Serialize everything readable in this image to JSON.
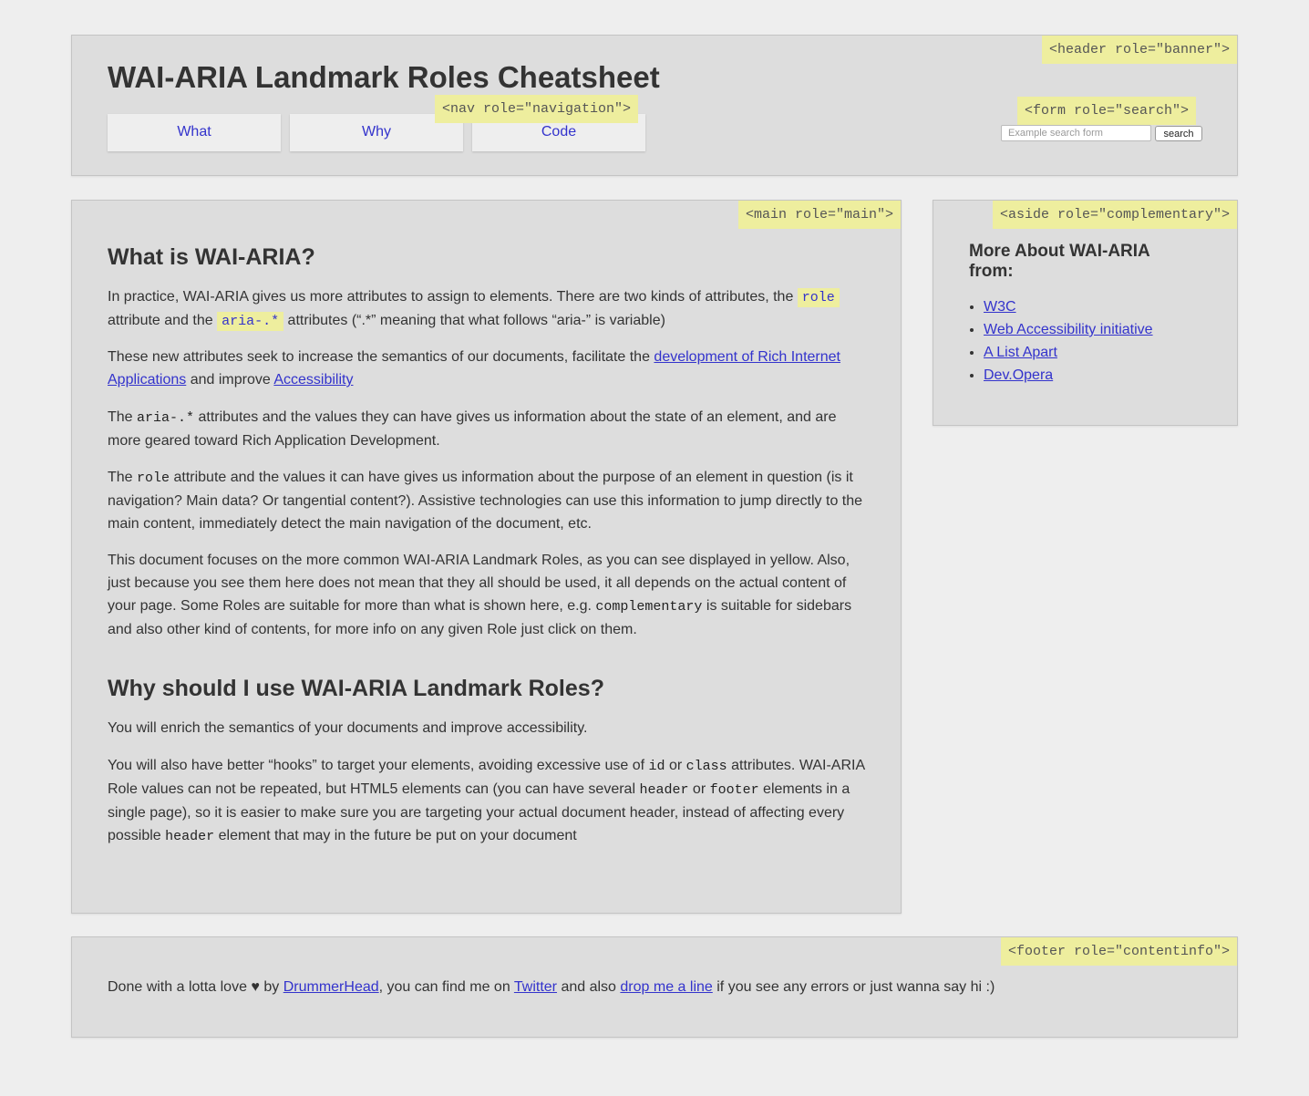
{
  "header": {
    "title": "WAI-ARIA Landmark Roles Cheatsheet",
    "role_tag": "<header role=\"banner\">",
    "nav_tag": "<nav role=\"navigation\">",
    "nav": [
      {
        "label": "What"
      },
      {
        "label": "Why"
      },
      {
        "label": "Code"
      }
    ],
    "search": {
      "role_tag": "<form role=\"search\">",
      "placeholder": "Example search form",
      "value": "",
      "button_label": "search"
    }
  },
  "main": {
    "role_tag": "<main role=\"main\">",
    "what": {
      "heading": "What is WAI-ARIA?",
      "p1": {
        "a": "In practice, WAI-ARIA gives us more attributes to assign to elements. There are two kinds of attributes, the ",
        "code1": "role",
        "b": " attribute and the ",
        "code2": "aria-.*",
        "c": " attributes (“.*” meaning that what follows “aria-” is variable)"
      },
      "p2": {
        "a": "These new attributes seek to increase the semantics of our documents, facilitate the ",
        "link1": "development of Rich Internet Applications",
        "b": " and improve ",
        "link2": "Accessibility"
      },
      "p3": {
        "a": "The ",
        "code": "aria-.*",
        "b": " attributes and the values they can have gives us information about the state of an element, and are more geared toward Rich Application Development."
      },
      "p4": {
        "a": "The ",
        "code": "role",
        "b": " attribute and the values it can have gives us information about the purpose of an element in question (is it navigation? Main data? Or tangential content?). Assistive technologies can use this information to jump directly to the main content, immediately detect the main navigation of the document, etc."
      },
      "p5": {
        "a": "This document focuses on the more common WAI-ARIA Landmark Roles, as you can see displayed in yellow. Also, just because you see them here does not mean that they all should be used, it all depends on the actual content of your page. Some Roles are suitable for more than what is shown here, e.g. ",
        "code": "complementary",
        "b": " is suitable for sidebars and also other kind of contents, for more info on any given Role just click on them."
      }
    },
    "why": {
      "heading": "Why should I use WAI-ARIA Landmark Roles?",
      "p1": "You will enrich the semantics of your documents and improve accessibility.",
      "p2": {
        "a": "You will also have better “hooks” to target your elements, avoiding excessive use of ",
        "code1": "id",
        "b": " or ",
        "code2": "class",
        "c": " attributes. WAI-ARIA Role values can not be repeated, but HTML5 elements can (you can have several ",
        "code3": "header",
        "d": " or ",
        "code4": "footer",
        "e": " elements in a single page), so it is easier to make sure you are targeting your actual document header, instead of affecting every possible ",
        "code5": "header",
        "f": " element that may in the future be put on your document"
      }
    }
  },
  "aside": {
    "role_tag": "<aside role=\"complementary\">",
    "heading": "More About WAI-ARIA from:",
    "links": [
      {
        "label": "W3C"
      },
      {
        "label": "Web Accessibility initiative"
      },
      {
        "label": "A List Apart"
      },
      {
        "label": "Dev.Opera"
      }
    ]
  },
  "footer": {
    "role_tag": "<footer role=\"contentinfo\">",
    "a": "Done with a lotta love ♥ by ",
    "link1": "DrummerHead",
    "b": ", you can find me on ",
    "link2": "Twitter",
    "c": " and also ",
    "link3": "drop me a line",
    "d": " if you see any errors or just wanna say hi :)"
  },
  "colors": {
    "page_bg": "#eeeeee",
    "box_bg": "#dddddd",
    "tag_bg": "#eeee9e",
    "link": "#3333cc"
  }
}
